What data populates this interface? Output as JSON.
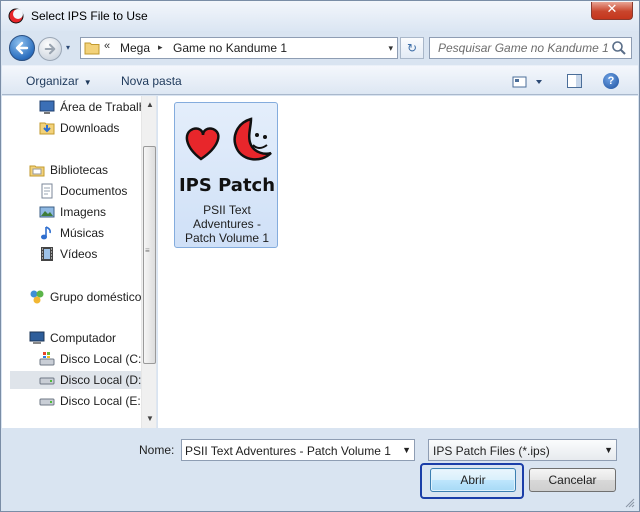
{
  "window": {
    "title": "Select IPS File to Use",
    "close_glyph": "✕",
    "app_icon": "app-logo-icon"
  },
  "navigation": {
    "back_icon": "back-arrow-icon",
    "forward_icon": "forward-arrow-icon",
    "address": {
      "overflow_glyph": "«",
      "crumbs": [
        "Mega",
        "Game no Kandume 1"
      ],
      "separator_glyph": "▸",
      "dropdown_glyph": "▾"
    },
    "refresh_glyph": "↻",
    "search_placeholder": "Pesquisar Game no Kandume 1"
  },
  "toolbar": {
    "organize_label": "Organizar",
    "organize_caret": "▼",
    "new_folder_label": "Nova pasta",
    "help_glyph": "?"
  },
  "sidebar": {
    "items": [
      {
        "label": "Área de Trabalh",
        "icon": "desktop-icon"
      },
      {
        "label": "Downloads",
        "icon": "downloads-folder-icon"
      },
      {
        "label": "Bibliotecas",
        "icon": "libraries-icon"
      },
      {
        "label": "Documentos",
        "icon": "documents-icon"
      },
      {
        "label": "Imagens",
        "icon": "pictures-icon"
      },
      {
        "label": "Músicas",
        "icon": "music-icon"
      },
      {
        "label": "Vídeos",
        "icon": "videos-icon"
      },
      {
        "label": "Grupo doméstico",
        "icon": "homegroup-icon"
      },
      {
        "label": "Computador",
        "icon": "computer-icon"
      },
      {
        "label": "Disco Local (C:)",
        "icon": "system-drive-icon"
      },
      {
        "label": "Disco Local (D:)",
        "icon": "drive-icon",
        "selected": true
      },
      {
        "label": "Disco Local (E:)",
        "icon": "drive-icon"
      }
    ],
    "scroll_up_glyph": "▲",
    "scroll_down_glyph": "▼",
    "grip_glyph": "≡"
  },
  "files": [
    {
      "thumbnail_text": "IPS Patch",
      "name": "PSII Text Adventures - Patch Volume 1",
      "selected": true
    }
  ],
  "footer": {
    "name_label": "Nome:",
    "name_value": "PSII Text Adventures - Patch Volume 1",
    "filter_value": "IPS Patch Files (*.ips)",
    "dropdown_glyph": "▼",
    "open_label": "Abrir",
    "cancel_label": "Cancelar"
  },
  "colors": {
    "chrome": "#d9e4f1",
    "selection": "#cfe0f7",
    "focus_ring": "#1b3ea8",
    "heart_red": "#e8262b"
  }
}
